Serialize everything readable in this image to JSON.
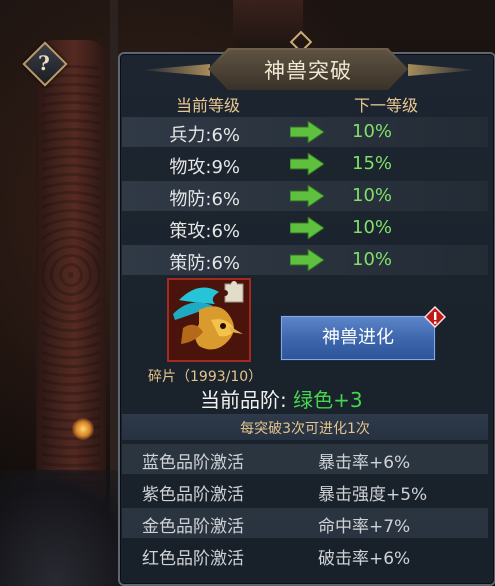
{
  "help": {
    "label": "?"
  },
  "panel": {
    "title": "神兽突破",
    "headers": {
      "current": "当前等级",
      "next": "下一等级"
    },
    "stats": [
      {
        "current": "兵力:6%",
        "next": "10%"
      },
      {
        "current": "物攻:9%",
        "next": "15%"
      },
      {
        "current": "物防:6%",
        "next": "10%"
      },
      {
        "current": "策攻:6%",
        "next": "10%"
      },
      {
        "current": "策防:6%",
        "next": "10%"
      }
    ],
    "fragment_label": "碎片（1993/10）",
    "evolve_button": "神兽进化",
    "grade_label": "当前品阶:",
    "grade_value": "绿色+3",
    "breakthrough_note": "每突破3次可进化1次",
    "quality_bonuses": [
      {
        "name": "蓝色品阶激活",
        "bonus": "暴击率+6%"
      },
      {
        "name": "紫色品阶激活",
        "bonus": "暴击强度+5%"
      },
      {
        "name": "金色品阶激活",
        "bonus": "命中率+7%"
      },
      {
        "name": "红色品阶激活",
        "bonus": "破击率+6%"
      }
    ]
  },
  "colors": {
    "next_value": "#7fe06a",
    "grade": "#44d64d",
    "button": "#3e67ad"
  }
}
